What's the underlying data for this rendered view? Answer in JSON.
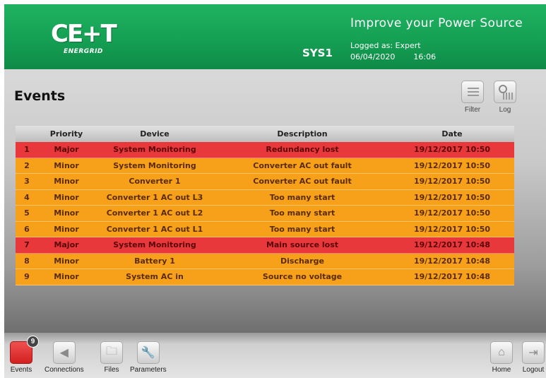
{
  "header": {
    "logo_text": "CE+T",
    "logo_sub": "ENERGRID",
    "tagline": "Improve your Power Source",
    "system": "SYS1",
    "logged_as": "Logged as: Expert",
    "date": "06/04/2020",
    "time": "16:06",
    "colors": {
      "header_green": "#15a054"
    }
  },
  "page": {
    "title": "Events",
    "tools": [
      {
        "label": "Filter",
        "icon": "filter-icon"
      },
      {
        "label": "Log",
        "icon": "log-icon"
      }
    ]
  },
  "table": {
    "columns": [
      "",
      "Priority",
      "Device",
      "Description",
      "Date"
    ],
    "rows": [
      {
        "num": "1",
        "priority": "Major",
        "device": "System Monitoring",
        "description": "Redundancy lost",
        "date": "19/12/2017 10:50"
      },
      {
        "num": "2",
        "priority": "Minor",
        "device": "System Monitoring",
        "description": "Converter AC out fault",
        "date": "19/12/2017 10:50"
      },
      {
        "num": "3",
        "priority": "Minor",
        "device": "Converter 1",
        "description": "Converter AC out fault",
        "date": "19/12/2017 10:50"
      },
      {
        "num": "4",
        "priority": "Minor",
        "device": "Converter 1 AC out L3",
        "description": "Too many start",
        "date": "19/12/2017 10:50"
      },
      {
        "num": "5",
        "priority": "Minor",
        "device": "Converter 1 AC out L2",
        "description": "Too many start",
        "date": "19/12/2017 10:50"
      },
      {
        "num": "6",
        "priority": "Minor",
        "device": "Converter 1 AC out L1",
        "description": "Too many start",
        "date": "19/12/2017 10:50"
      },
      {
        "num": "7",
        "priority": "Major",
        "device": "System Monitoring",
        "description": "Main source lost",
        "date": "19/12/2017 10:48"
      },
      {
        "num": "8",
        "priority": "Minor",
        "device": "Battery 1",
        "description": "Discharge",
        "date": "19/12/2017 10:48"
      },
      {
        "num": "9",
        "priority": "Minor",
        "device": "System AC in",
        "description": "Source no voltage",
        "date": "19/12/2017 10:48"
      }
    ],
    "colors": {
      "major": "#e8383c",
      "minor": "#f7a11a"
    }
  },
  "nav": {
    "items": [
      {
        "label": "Events",
        "icon": "events-icon",
        "badge": "9",
        "active": true
      },
      {
        "label": "Connections",
        "icon": "connections-icon"
      },
      {
        "label": "Files",
        "icon": "folder-icon"
      },
      {
        "label": "Parameters",
        "icon": "wrench-icon"
      },
      {
        "label": "Home",
        "icon": "home-icon"
      },
      {
        "label": "Logout",
        "icon": "logout-icon"
      }
    ]
  }
}
